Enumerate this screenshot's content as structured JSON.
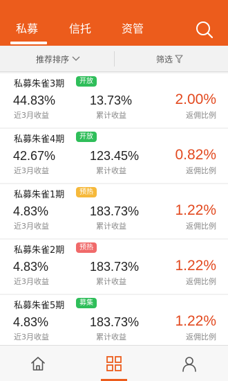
{
  "header": {
    "tabs": [
      {
        "label": "私募",
        "active": true
      },
      {
        "label": "信托",
        "active": false
      },
      {
        "label": "资管",
        "active": false
      }
    ],
    "search_icon": "search-icon"
  },
  "filter_bar": {
    "sort_label": "推荐排序",
    "filter_label": "筛选"
  },
  "labels": {
    "recent_return": "近3月收益",
    "cumulative_return": "累计收益",
    "rebate_ratio": "返佣比例"
  },
  "products": [
    {
      "name": "私募朱雀3期",
      "tag": "开放",
      "tag_color": "#2fbe5a",
      "recent": "44.83%",
      "cumulative": "13.73%",
      "rebate": "2.00%"
    },
    {
      "name": "私募朱雀4期",
      "tag": "开放",
      "tag_color": "#2fbe5a",
      "recent": "42.67%",
      "cumulative": "123.45%",
      "rebate": "0.82%"
    },
    {
      "name": "私募朱雀1期",
      "tag": "预热",
      "tag_color": "#f6b93b",
      "recent": "4.83%",
      "cumulative": "183.73%",
      "rebate": "1.22%"
    },
    {
      "name": "私募朱雀2期",
      "tag": "预热",
      "tag_color": "#f06a6a",
      "recent": "4.83%",
      "cumulative": "183.73%",
      "rebate": "1.22%"
    },
    {
      "name": "私募朱雀5期",
      "tag": "募集",
      "tag_color": "#2fbe5a",
      "recent": "4.83%",
      "cumulative": "183.73%",
      "rebate": "1.22%"
    }
  ],
  "bottom_nav": {
    "items": [
      {
        "icon": "home-icon",
        "active": false
      },
      {
        "icon": "grid-icon",
        "active": true
      },
      {
        "icon": "user-icon",
        "active": false
      }
    ]
  },
  "colors": {
    "brand": "#ec5c1c",
    "rebate": "#e2491f"
  }
}
